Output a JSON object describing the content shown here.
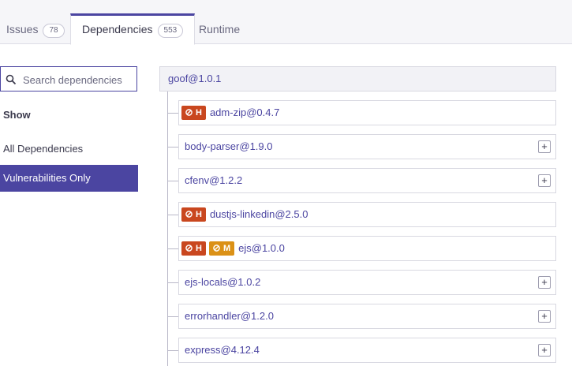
{
  "tabs": [
    {
      "label": "Issues",
      "count": "78"
    },
    {
      "label": "Dependencies",
      "count": "553",
      "active": true
    },
    {
      "label": "Runtime"
    }
  ],
  "sidebar": {
    "search_placeholder": "Search dependencies",
    "show_label": "Show",
    "filters": [
      {
        "label": "All Dependencies",
        "selected": false
      },
      {
        "label": "Vulnerabilities Only",
        "selected": true
      }
    ]
  },
  "tree": {
    "root": "goof@1.0.1",
    "nodes": [
      {
        "name": "adm-zip@0.4.7",
        "badges": [
          "H"
        ],
        "expandable": false
      },
      {
        "name": "body-parser@1.9.0",
        "badges": [],
        "expandable": true
      },
      {
        "name": "cfenv@1.2.2",
        "badges": [],
        "expandable": true
      },
      {
        "name": "dustjs-linkedin@2.5.0",
        "badges": [
          "H"
        ],
        "expandable": false
      },
      {
        "name": "ejs@1.0.0",
        "badges": [
          "H",
          "M"
        ],
        "expandable": false
      },
      {
        "name": "ejs-locals@1.0.2",
        "badges": [],
        "expandable": true
      },
      {
        "name": "errorhandler@1.2.0",
        "badges": [],
        "expandable": true
      },
      {
        "name": "express@4.12.4",
        "badges": [],
        "expandable": true
      }
    ],
    "expand_symbol": "+"
  },
  "colors": {
    "accent": "#4b45a1",
    "high": "#c9471f",
    "medium": "#db9116"
  }
}
